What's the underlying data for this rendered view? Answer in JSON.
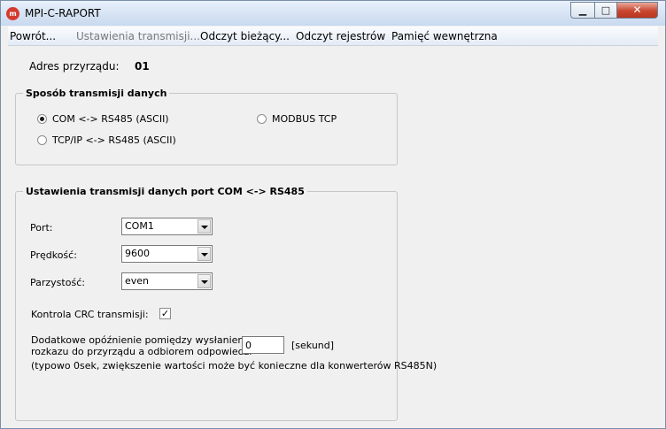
{
  "window": {
    "title": "MPI-C-RAPORT",
    "app_icon_text": "m",
    "controls": {
      "minimize": "▁",
      "maximize": "□",
      "close": "✕"
    }
  },
  "menu": [
    {
      "label": "Powrót...",
      "enabled": true
    },
    {
      "label": "Ustawienia transmisji...",
      "enabled": false
    },
    {
      "label": "Odczyt bieżący...",
      "enabled": true
    },
    {
      "label": "Odczyt rejestrów",
      "enabled": true
    },
    {
      "label": "Pamięć wewnętrzna",
      "enabled": true
    }
  ],
  "device_address": {
    "label": "Adres przyrządu:",
    "value": "01"
  },
  "transmission_mode": {
    "title": "Sposób transmisji danych",
    "options": [
      {
        "label": "COM <-> RS485 (ASCII)",
        "checked": true
      },
      {
        "label": "MODBUS TCP",
        "checked": false
      },
      {
        "label": "TCP/IP <-> RS485 (ASCII)",
        "checked": false
      }
    ]
  },
  "com_settings": {
    "title": "Ustawienia transmisji danych port COM <-> RS485",
    "port": {
      "label": "Port:",
      "value": "COM1"
    },
    "speed": {
      "label": "Prędkość:",
      "value": "9600"
    },
    "parity": {
      "label": "Parzystość:",
      "value": "even"
    },
    "crc": {
      "label": "Kontrola CRC transmisji:",
      "checked": true,
      "mark": "✓"
    },
    "delay": {
      "label_line1": "Dodatkowe opóźnienie pomiędzy wysłaniem",
      "label_line2": "rozkazu do przyrządu a odbiorem odpowiedzi",
      "value": "0",
      "unit": "[sekund]",
      "note": "(typowo 0sek, zwiększenie wartości może być konieczne dla konwerterów RS485N)"
    }
  }
}
